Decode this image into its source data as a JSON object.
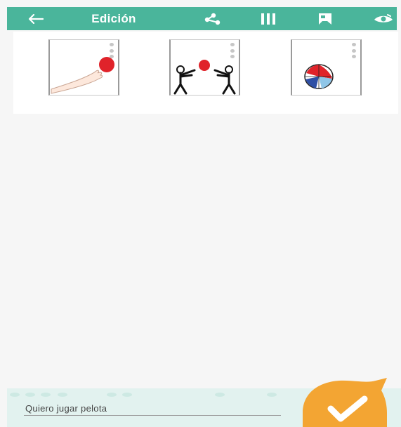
{
  "topbar": {
    "title": "Edición",
    "background": "#4ab59b",
    "icons": [
      "arrow-left-icon",
      "share-icon",
      "columns-icon",
      "board-icon",
      "eye-icon"
    ]
  },
  "pictograms": [
    {
      "name": "lanzar",
      "icon": "hand-throwing-ball-picto"
    },
    {
      "name": "jugar a la pelota",
      "icon": "two-people-playing-ball-picto"
    },
    {
      "name": "pelota",
      "icon": "beach-ball-picto"
    }
  ],
  "phrase": {
    "text": "Quiero jugar pelota"
  },
  "confirm": {
    "icon": "check-icon",
    "color": "#f3a533"
  }
}
